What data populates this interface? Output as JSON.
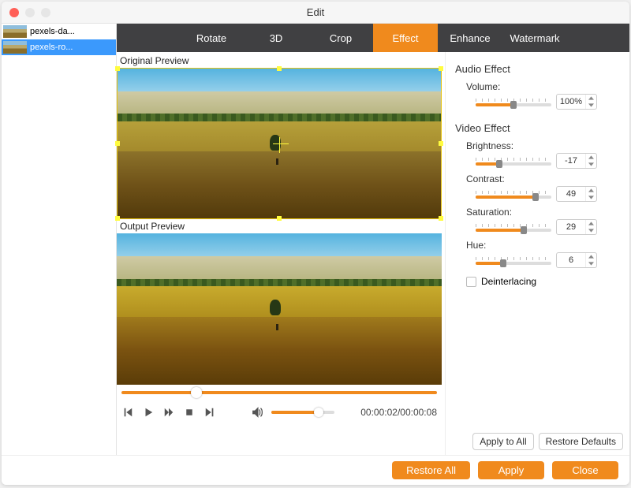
{
  "window": {
    "title": "Edit"
  },
  "sidebar": {
    "items": [
      {
        "label": "pexels-da...",
        "selected": false
      },
      {
        "label": "pexels-ro...",
        "selected": true
      }
    ]
  },
  "tabs": [
    {
      "label": "Rotate",
      "active": false
    },
    {
      "label": "3D",
      "active": false
    },
    {
      "label": "Crop",
      "active": false
    },
    {
      "label": "Effect",
      "active": true
    },
    {
      "label": "Enhance",
      "active": false
    },
    {
      "label": "Watermark",
      "active": false
    }
  ],
  "preview": {
    "original_label": "Original Preview",
    "output_label": "Output Preview",
    "time": "00:00:02/00:00:08"
  },
  "panel": {
    "audio_section": "Audio Effect",
    "video_section": "Video Effect",
    "volume": {
      "label": "Volume:",
      "value": "100%",
      "percent": 50
    },
    "brightness": {
      "label": "Brightness:",
      "value": "-17",
      "percent": 30
    },
    "contrast": {
      "label": "Contrast:",
      "value": "49",
      "percent": 78
    },
    "saturation": {
      "label": "Saturation:",
      "value": "29",
      "percent": 62
    },
    "hue": {
      "label": "Hue:",
      "value": "6",
      "percent": 35
    },
    "deinterlacing_label": "Deinterlacing",
    "apply_all": "Apply to All",
    "restore_defaults": "Restore Defaults"
  },
  "footer": {
    "restore_all": "Restore All",
    "apply": "Apply",
    "close": "Close"
  }
}
